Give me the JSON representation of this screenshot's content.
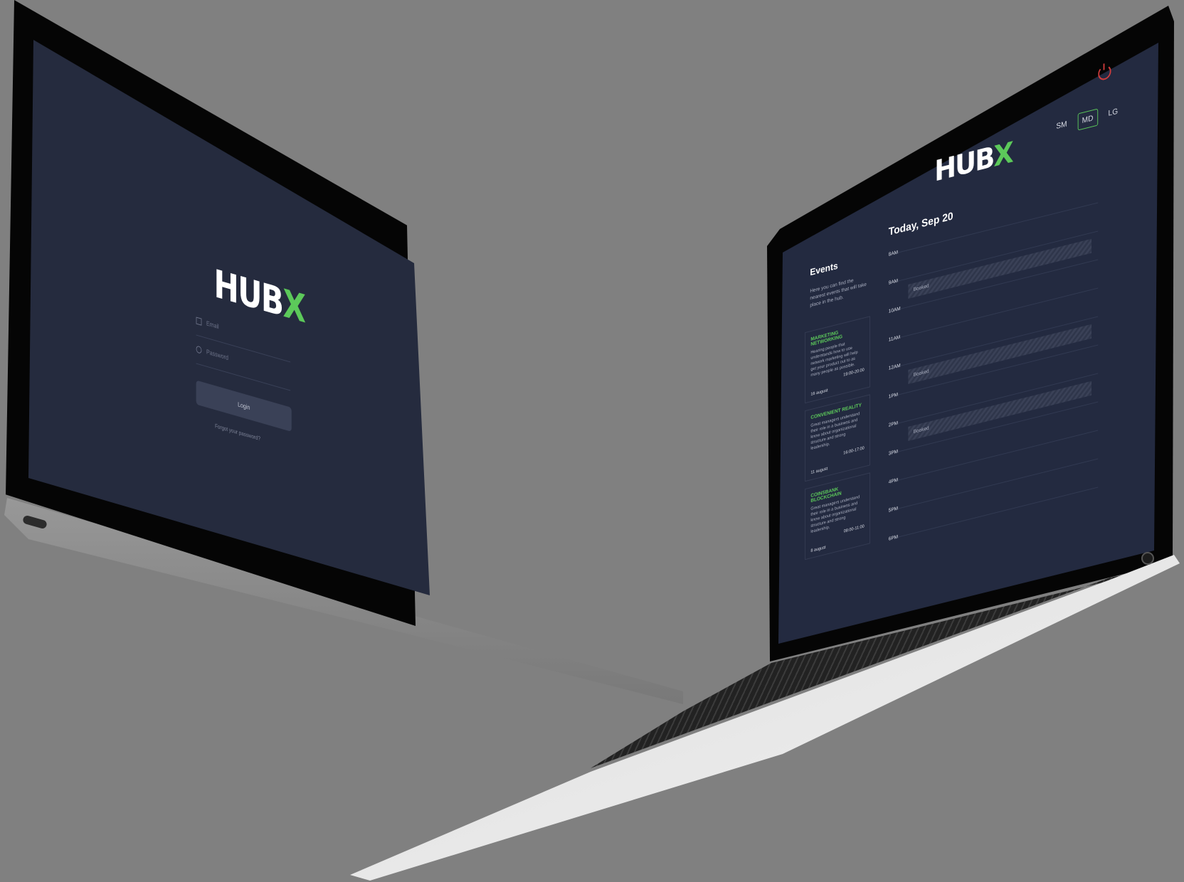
{
  "login": {
    "logo_text": "HUB",
    "logo_accent": "X",
    "email_placeholder": "Email",
    "password_placeholder": "Password",
    "login_label": "Login",
    "forgot_label": "Forgot your password?"
  },
  "dashboard": {
    "logo_text": "HUB",
    "logo_accent": "X",
    "size_tabs": [
      "SM",
      "MD",
      "LG"
    ],
    "active_size": "MD",
    "today": "Today, Sep 20",
    "events_title": "Events",
    "events_description": "Here you can find the nearest events that will take place in the hub.",
    "events": [
      {
        "title": "MARKETING NETWORKING",
        "description": "Hearing people that understands how to use network marketing will help get your product out to as many people as possible.",
        "time": "19:00-20:00",
        "date": "16 august"
      },
      {
        "title": "CONVENIENT REALITY",
        "description": "Great managers understand their role in a business and know about organizational structure and strong leadership.",
        "time": "16:00-17:00",
        "date": "11 august"
      },
      {
        "title": "COINSBANK BLOCKCHAIN",
        "description": "Great managers understand their role in a business and know about organizational structure and strong leadership.",
        "time": "08:00-11:00",
        "date": "8 august"
      }
    ],
    "hours": [
      "8AM",
      "9AM",
      "10AM",
      "11AM",
      "12AM",
      "1PM",
      "2PM",
      "3PM",
      "4PM",
      "5PM",
      "6PM"
    ],
    "booked_label": "Booked",
    "colors": {
      "accent": "#5cc95a",
      "screen_bg": "#232a40",
      "power": "#d23c3c"
    }
  }
}
